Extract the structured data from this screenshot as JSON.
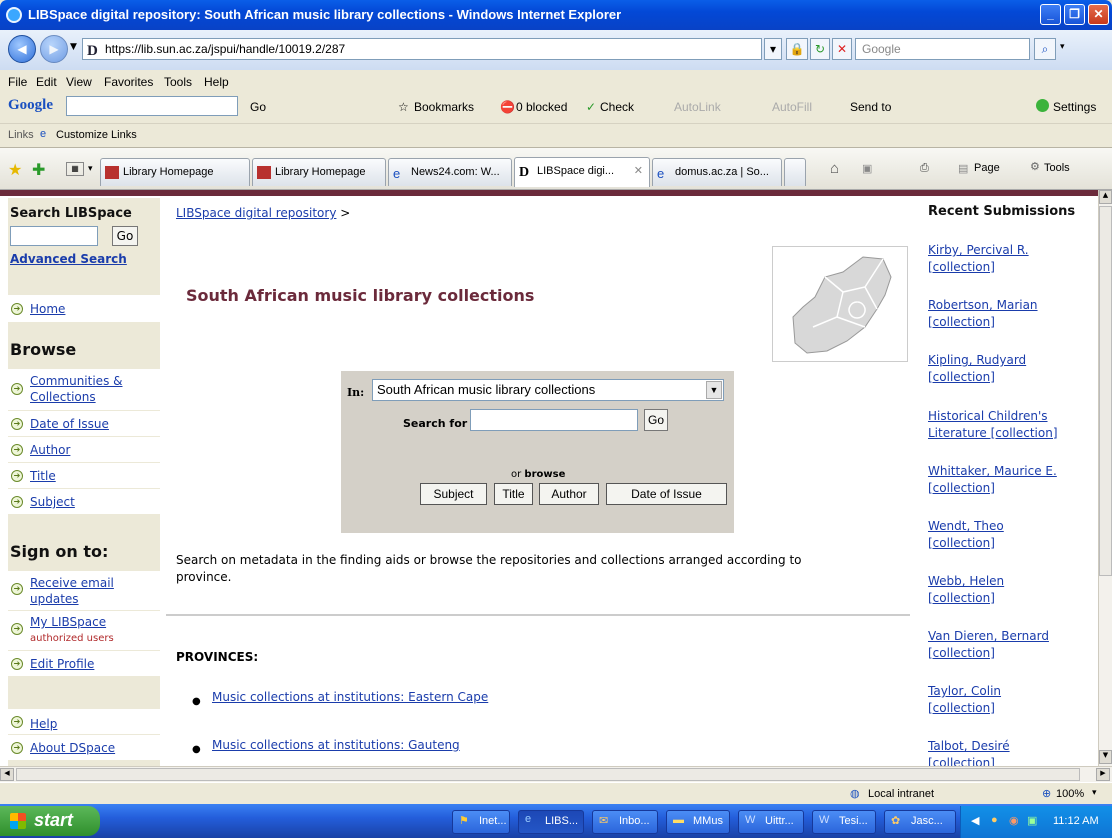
{
  "window": {
    "title": "LIBSpace digital repository: South African music library collections - Windows Internet Explorer"
  },
  "address": {
    "url": "https://lib.sun.ac.za/jspui/handle/10019.2/287",
    "search_placeholder": "Google"
  },
  "menu": [
    "File",
    "Edit",
    "View",
    "Favorites",
    "Tools",
    "Help"
  ],
  "google_toolbar": {
    "go": "Go",
    "bookmarks": "Bookmarks",
    "blocked": "0 blocked",
    "check": "Check",
    "autolink": "AutoLink",
    "autofill": "AutoFill",
    "send_to": "Send to",
    "settings": "Settings"
  },
  "links_bar": {
    "links": "Links",
    "customize": "Customize Links"
  },
  "tabs": [
    "Library Homepage",
    "Library Homepage",
    "News24.com: W...",
    "LIBSpace digi...",
    "domus.ac.za | So..."
  ],
  "command_bar": {
    "page": "Page",
    "tools": "Tools"
  },
  "left": {
    "search_title": "Search LIBSpace",
    "go": "Go",
    "advanced": "Advanced Search",
    "home": "Home",
    "browse_title": "Browse",
    "browse_items": [
      "Communities & Collections",
      "Date of Issue",
      "Author",
      "Title",
      "Subject"
    ],
    "signon_title": "Sign on to:",
    "receive": "Receive email updates",
    "mylib": "My LIBSpace",
    "mylib_note": "authorized users",
    "edit_profile": "Edit Profile",
    "help": "Help",
    "about": "About DSpace"
  },
  "main": {
    "breadcrumb": "LIBSpace digital repository",
    "breadcrumb_sep": ">",
    "title": "South African music library collections",
    "in_label": "In:",
    "scope": "South African music library collections",
    "search_for": "Search for",
    "go": "Go",
    "or": "or",
    "browse": "browse",
    "buttons": [
      "Subject",
      "Title",
      "Author",
      "Date of Issue"
    ],
    "description": "Search on metadata in the finding aids or browse the repositories and collections arranged according to province.",
    "provinces_title": "PROVINCES:",
    "provinces": [
      "Music collections at institutions: Eastern Cape",
      "Music collections at institutions: Gauteng"
    ]
  },
  "recent": {
    "title": "Recent Submissions",
    "items": [
      [
        "Kirby, Percival R.",
        "[collection]"
      ],
      [
        "Robertson, Marian",
        "[collection]"
      ],
      [
        "Kipling, Rudyard",
        "[collection]"
      ],
      [
        "Historical Children's",
        "Literature [collection]"
      ],
      [
        "Whittaker, Maurice E.",
        "[collection]"
      ],
      [
        "Wendt, Theo",
        "[collection]"
      ],
      [
        "Webb, Helen",
        "[collection]"
      ],
      [
        "Van Dieren, Bernard",
        "[collection]"
      ],
      [
        "Taylor, Colin",
        "[collection]"
      ],
      [
        "Talbot, Desiré",
        "[collection]"
      ]
    ]
  },
  "status": {
    "zone": "Local intranet",
    "zoom": "100%"
  },
  "taskbar": {
    "start": "start",
    "tasks": [
      "Inet...",
      "LIBS...",
      "Inbo...",
      "MMus",
      "Uittr...",
      "Tesi...",
      "Jasc..."
    ],
    "clock": "11:12 AM"
  }
}
